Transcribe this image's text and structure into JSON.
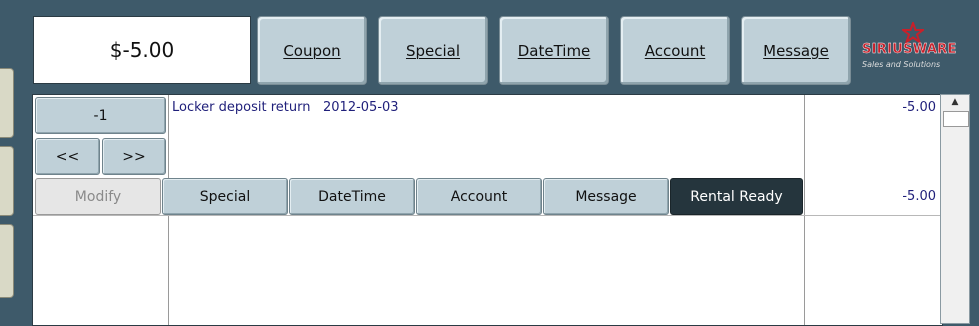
{
  "total": "$-5.00",
  "toolbar": {
    "coupon_label": "Coupon",
    "special_label": "Special",
    "datetime_label": "DateTime",
    "account_label": "Account",
    "message_label": "Message"
  },
  "brand": {
    "name": "SIRIUSWARE",
    "tagline": "Sales and Solutions"
  },
  "line_item": {
    "quantity_label": "-1",
    "prev_label": "<<",
    "next_label": ">>",
    "description": "Locker deposit return",
    "date": "2012-05-03",
    "amount": "-5.00",
    "subtotal": "-5.00"
  },
  "actions": {
    "modify_label": "Modify",
    "special_label": "Special",
    "datetime_label": "DateTime",
    "account_label": "Account",
    "message_label": "Message",
    "rental_ready_label": "Rental Ready"
  },
  "scrollbar": {
    "up_arrow": "▲"
  },
  "colors": {
    "background": "#3e5a6a",
    "button": "#bfd0d8",
    "brand_red": "#c8202a",
    "text_blue": "#1f1f7a"
  }
}
